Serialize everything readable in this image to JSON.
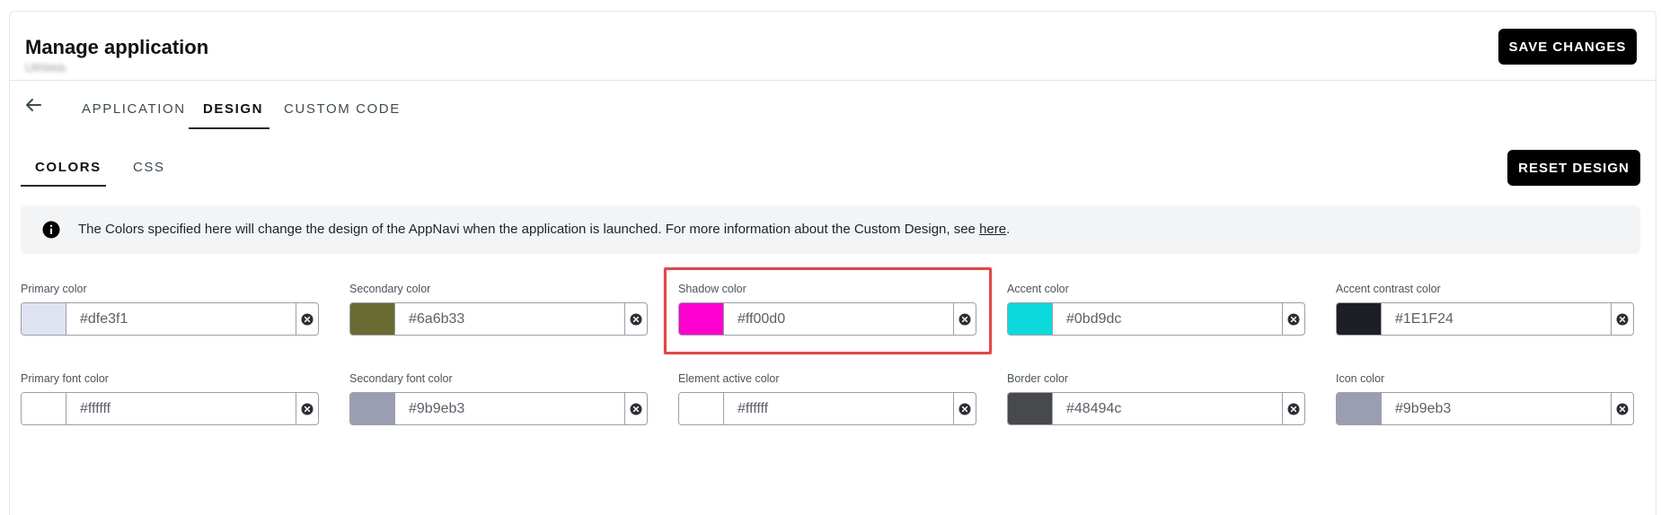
{
  "header": {
    "title": "Manage application",
    "subtitle": "URWeb",
    "save_label": "SAVE CHANGES"
  },
  "nav": {
    "tabs": [
      {
        "label": "APPLICATION"
      },
      {
        "label": "DESIGN",
        "active": true
      },
      {
        "label": "CUSTOM CODE"
      }
    ]
  },
  "subnav": {
    "tabs": [
      {
        "label": "COLORS",
        "active": true
      },
      {
        "label": "CSS"
      }
    ],
    "reset_label": "RESET DESIGN"
  },
  "info": {
    "text": "The Colors specified here will change the design of the AppNavi when the application is launched. For more information about the Custom Design, see ",
    "link": "here",
    "suffix": "."
  },
  "colors": [
    {
      "label": "Primary color",
      "value": "#dfe3f1",
      "swatch": "#dfe3f1"
    },
    {
      "label": "Secondary color",
      "value": "#6a6b33",
      "swatch": "#6a6b33"
    },
    {
      "label": "Shadow color",
      "value": "#ff00d0",
      "swatch": "#ff00d0"
    },
    {
      "label": "Accent color",
      "value": "#0bd9dc",
      "swatch": "#0bd9dc"
    },
    {
      "label": "Accent contrast color",
      "value": "#1E1F24",
      "swatch": "#1E1F24"
    },
    {
      "label": "Primary font color",
      "value": "#ffffff",
      "swatch": "#ffffff"
    },
    {
      "label": "Secondary font color",
      "value": "#9b9eb3",
      "swatch": "#9b9eb3"
    },
    {
      "label": "Element active color",
      "value": "#ffffff",
      "swatch": "#ffffff"
    },
    {
      "label": "Border color",
      "value": "#48494c",
      "swatch": "#48494c"
    },
    {
      "label": "Icon color",
      "value": "#9b9eb3",
      "swatch": "#9b9eb3"
    }
  ],
  "highlighted_field": "Shadow color",
  "icons": {
    "back": "arrow-left-icon",
    "info": "info-circle-icon",
    "clear": "clear-circle-icon"
  }
}
